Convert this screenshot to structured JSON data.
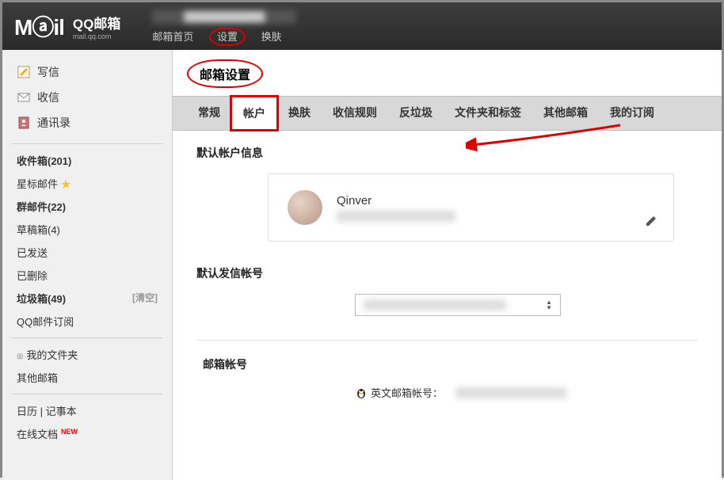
{
  "header": {
    "logo_text": "Mⓐil",
    "brand_main": "QQ邮箱",
    "brand_sub": "mail.qq.com",
    "user_display": "████████████",
    "nav": {
      "home": "邮箱首页",
      "settings": "设置",
      "skin": "换肤"
    }
  },
  "sidebar": {
    "compose": "写信",
    "receive": "收信",
    "contacts": "通讯录",
    "folders": {
      "inbox": "收件箱(201)",
      "starred": "星标邮件",
      "group": "群邮件(22)",
      "drafts": "草稿箱(4)",
      "sent": "已发送",
      "deleted": "已删除",
      "spam": "垃圾箱(49)",
      "spam_action": "[清空]",
      "subscription": "QQ邮件订阅"
    },
    "extras": {
      "myfolder": "我的文件夹",
      "other_mailbox": "其他邮箱",
      "calendar": "日历",
      "notes": "记事本",
      "docs": "在线文档",
      "docs_badge": "NEW"
    }
  },
  "main": {
    "title": "邮箱设置",
    "tabs": {
      "general": "常规",
      "account": "帐户",
      "skin": "换肤",
      "rules": "收信规则",
      "spam": "反垃圾",
      "folders": "文件夹和标签",
      "other": "其他邮箱",
      "subscription": "我的订阅"
    },
    "sections": {
      "default_account_title": "默认帐户信息",
      "account_name": "Qinver",
      "default_sender_title": "默认发信帐号",
      "mailbox_title": "邮箱帐号",
      "english_mailbox_label": "英文邮箱帐号："
    }
  }
}
